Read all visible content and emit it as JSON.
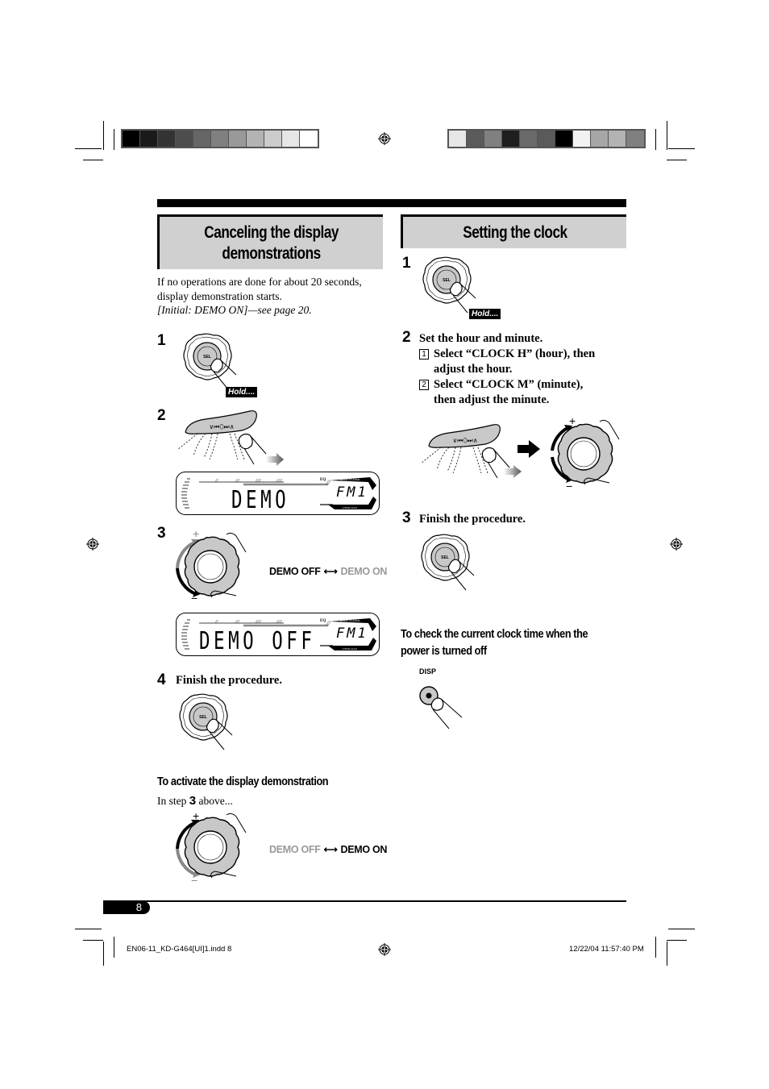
{
  "page": {
    "number": "8",
    "slug_left": "EN06-11_KD-G464[UI]1.indd   8",
    "slug_right": "12/22/04   11:57:40 PM"
  },
  "colorbars": {
    "left": [
      "#000000",
      "#1a1a1a",
      "#333333",
      "#4d4d4d",
      "#666666",
      "#808080",
      "#999999",
      "#b3b3b3",
      "#cccccc",
      "#e6e6e6",
      "#ffffff"
    ],
    "right": [
      "#e6e6e6",
      "#5a5a5a",
      "#808080",
      "#1e1e1e",
      "#6a6a6a",
      "#5a5a5a",
      "#000000",
      "#f2f2f2",
      "#a6a6a6",
      "#b3b3b3",
      "#808080"
    ]
  },
  "left": {
    "title_line1": "Canceling the display",
    "title_line2": "demonstrations",
    "intro_line1": "If no operations are done for about 20 seconds,",
    "intro_line2": "display demonstration starts.",
    "intro_line3": "[Initial: DEMO ON]—see page 20.",
    "steps": [
      {
        "num": "1",
        "hold": "Hold...."
      },
      {
        "num": "2",
        "lcd_main": "DEMO",
        "lcd_source": "FM1"
      },
      {
        "num": "3",
        "toggle_a": "DEMO OFF",
        "toggle_b": "DEMO ON",
        "lcd_main": "DEMO OFF",
        "lcd_source": "FM1"
      },
      {
        "num": "4",
        "text": "Finish the procedure."
      }
    ],
    "activate": {
      "heading": "To activate the display demonstration",
      "text_pre": "In step ",
      "text_step": "3",
      "text_post": " above...",
      "toggle_a": "DEMO OFF",
      "toggle_b": "DEMO ON"
    }
  },
  "right": {
    "title": "Setting the clock",
    "steps": [
      {
        "num": "1",
        "hold": "Hold...."
      },
      {
        "num": "2",
        "text": "Set the hour and minute.",
        "substeps": [
          {
            "num": "1",
            "line1": "Select “CLOCK H” (hour), then",
            "line2": "adjust the hour."
          },
          {
            "num": "2",
            "line1": "Select “CLOCK M” (minute),",
            "line2": "then adjust the minute."
          }
        ]
      },
      {
        "num": "3",
        "text": "Finish the procedure."
      }
    ],
    "check": {
      "heading_line1": "To check the current clock time when the",
      "heading_line2": "power is turned off",
      "button_label": "DISP"
    }
  },
  "lcd_labels": {
    "top": "ROCK CLASSIC",
    "bottom": "USER  JAZZ",
    "eq": "EQ"
  }
}
